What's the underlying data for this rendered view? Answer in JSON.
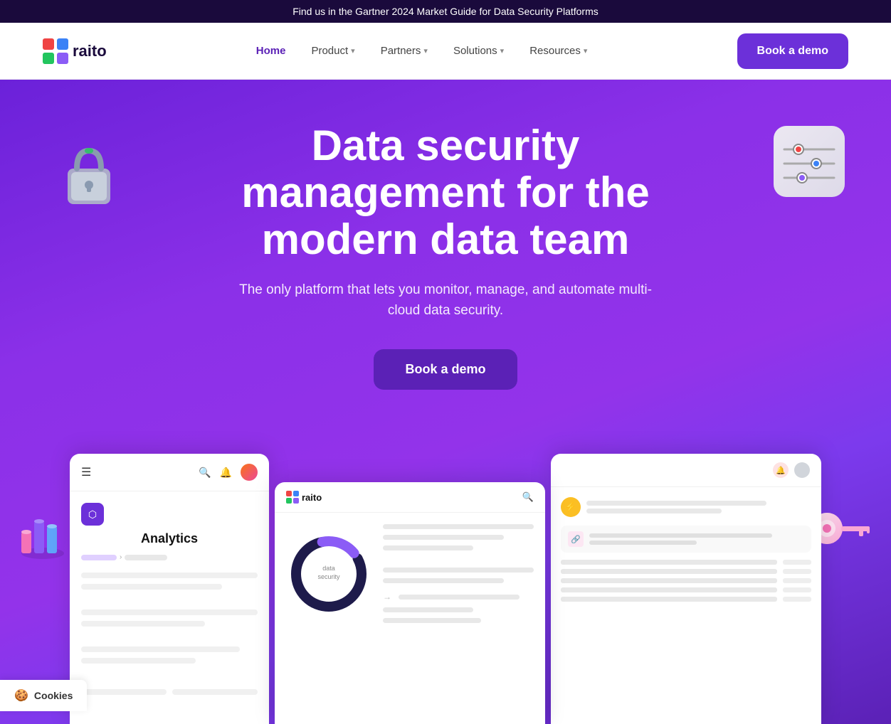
{
  "banner": {
    "text": "Find us in the Gartner 2024 Market Guide for Data Security Platforms"
  },
  "nav": {
    "logo_text": "raito",
    "links": [
      {
        "label": "Home",
        "active": true,
        "has_dropdown": false
      },
      {
        "label": "Product",
        "active": false,
        "has_dropdown": true
      },
      {
        "label": "Partners",
        "active": false,
        "has_dropdown": true
      },
      {
        "label": "Solutions",
        "active": false,
        "has_dropdown": true
      },
      {
        "label": "Resources",
        "active": false,
        "has_dropdown": true
      }
    ],
    "cta_label": "Book a demo"
  },
  "hero": {
    "title": "Data security management for the modern data team",
    "subtitle": "The only platform that lets you monitor, manage, and automate multi-cloud data security.",
    "cta_label": "Book a demo"
  },
  "mockup": {
    "analytics_title": "Analytics",
    "left_header": "raito",
    "center_search": "🔍"
  },
  "cookies": {
    "label": "Cookies"
  },
  "colors": {
    "primary": "#6c30d9",
    "hero_bg_start": "#6b21d9",
    "hero_bg_end": "#9333ea",
    "banner_bg": "#1a0a3c",
    "cta_bg": "#5b21b6",
    "white": "#ffffff"
  }
}
